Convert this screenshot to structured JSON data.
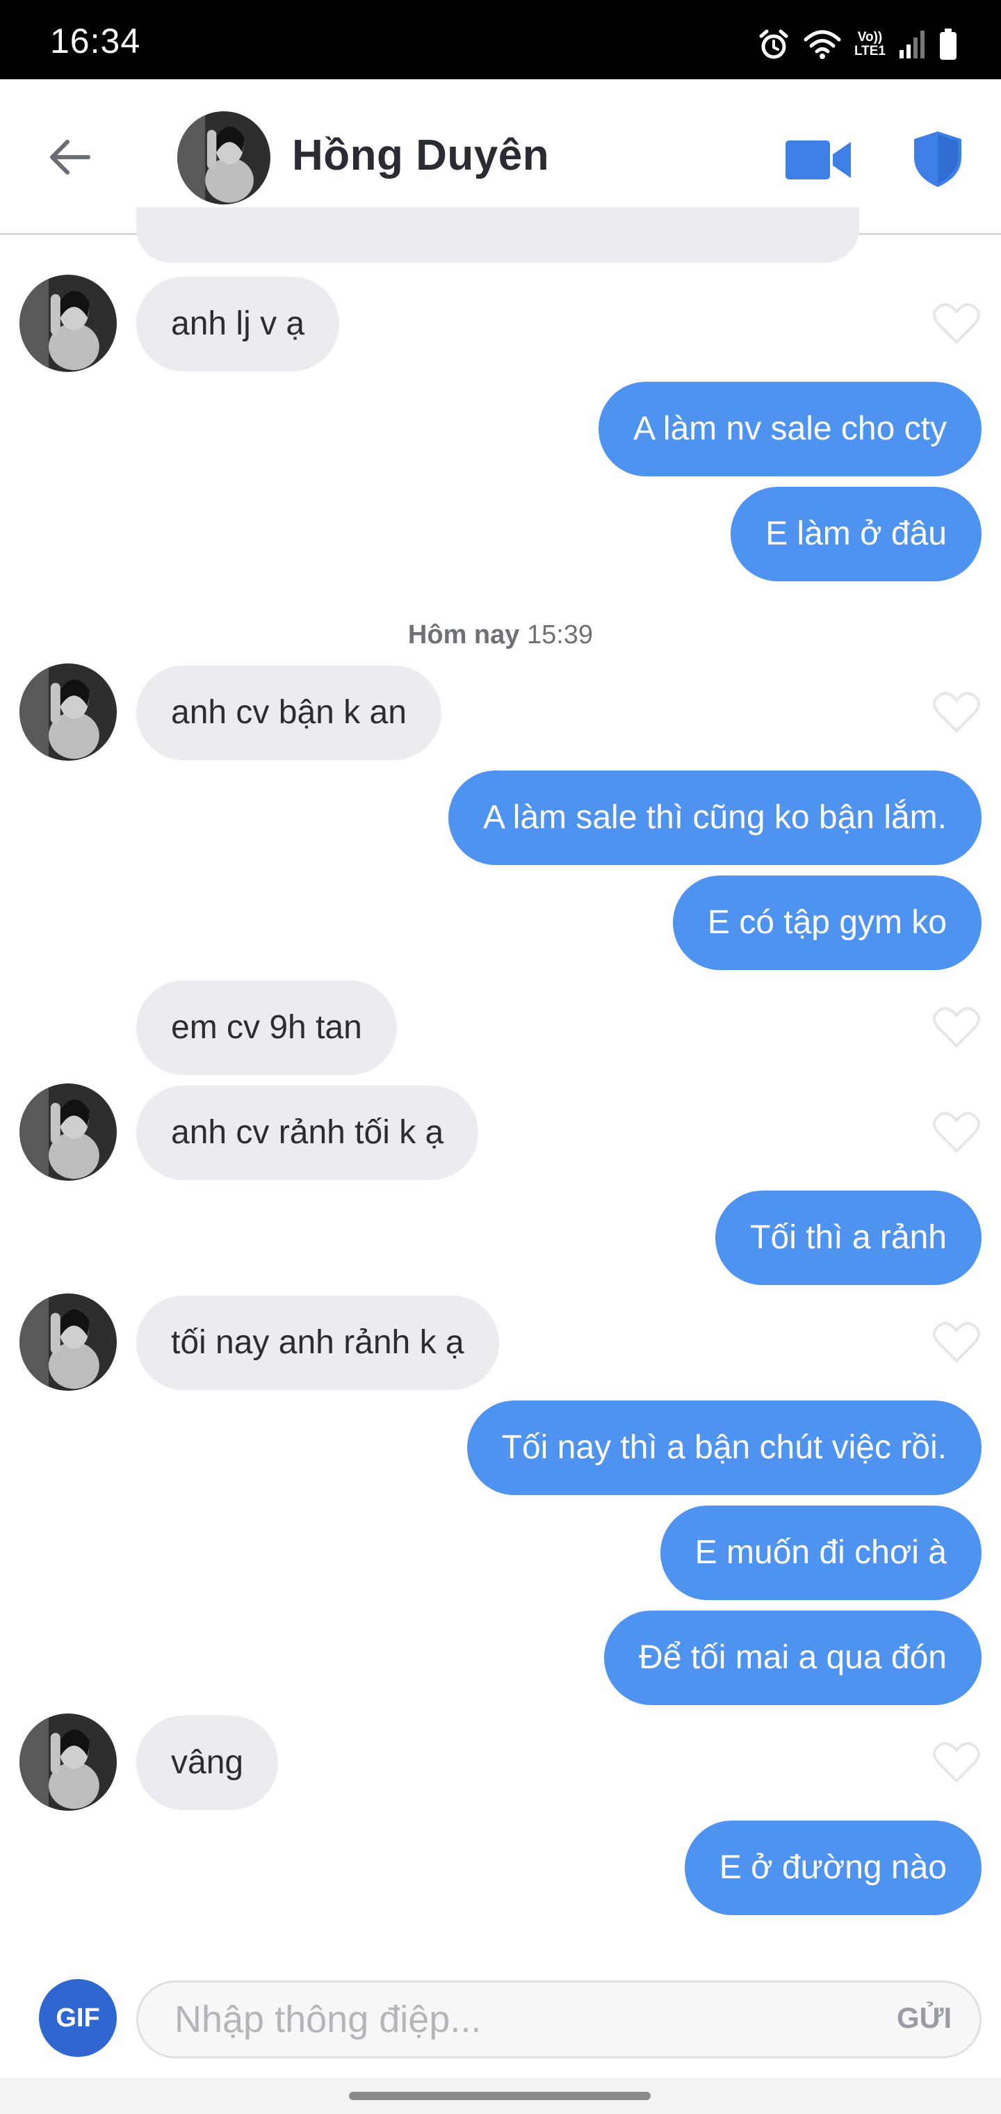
{
  "status_bar": {
    "time": "16:34",
    "lte_line1": "Vo))",
    "lte_line2": "LTE1"
  },
  "header": {
    "contact_name": "Hồng Duyên"
  },
  "messages": [
    {
      "text": "anh lj v ạ"
    },
    {
      "text": "A làm nv sale cho cty"
    },
    {
      "text": "E làm ở đâu"
    },
    {
      "text": "anh cv bận k an"
    },
    {
      "text": "A làm sale thì cũng ko bận lắm."
    },
    {
      "text": "E có tập gym ko"
    },
    {
      "text": "em cv 9h tan"
    },
    {
      "text": "anh cv rảnh tối k ạ"
    },
    {
      "text": "Tối thì a rảnh"
    },
    {
      "text": "tối nay anh rảnh k ạ"
    },
    {
      "text": "Tối nay thì a bận chút việc rồi."
    },
    {
      "text": "E muốn đi chơi à"
    },
    {
      "text": "Để tối mai a qua đón"
    },
    {
      "text": "vâng"
    },
    {
      "text": "E ở đường nào"
    }
  ],
  "timestamp": {
    "day": "Hôm nay",
    "time": "15:39"
  },
  "composer": {
    "gif_label": "GIF",
    "placeholder": "Nhập thông điệp...",
    "send_label": "GỬI"
  },
  "colors": {
    "outgoing_bubble": "#4f93f0",
    "incoming_bubble": "#ebecef",
    "accent": "#3d7fe6",
    "gif_button": "#2f66d0"
  },
  "icons": {
    "back": "arrow-left-icon",
    "video": "video-camera-icon",
    "safety": "shield-icon",
    "like": "heart-outline-icon"
  }
}
